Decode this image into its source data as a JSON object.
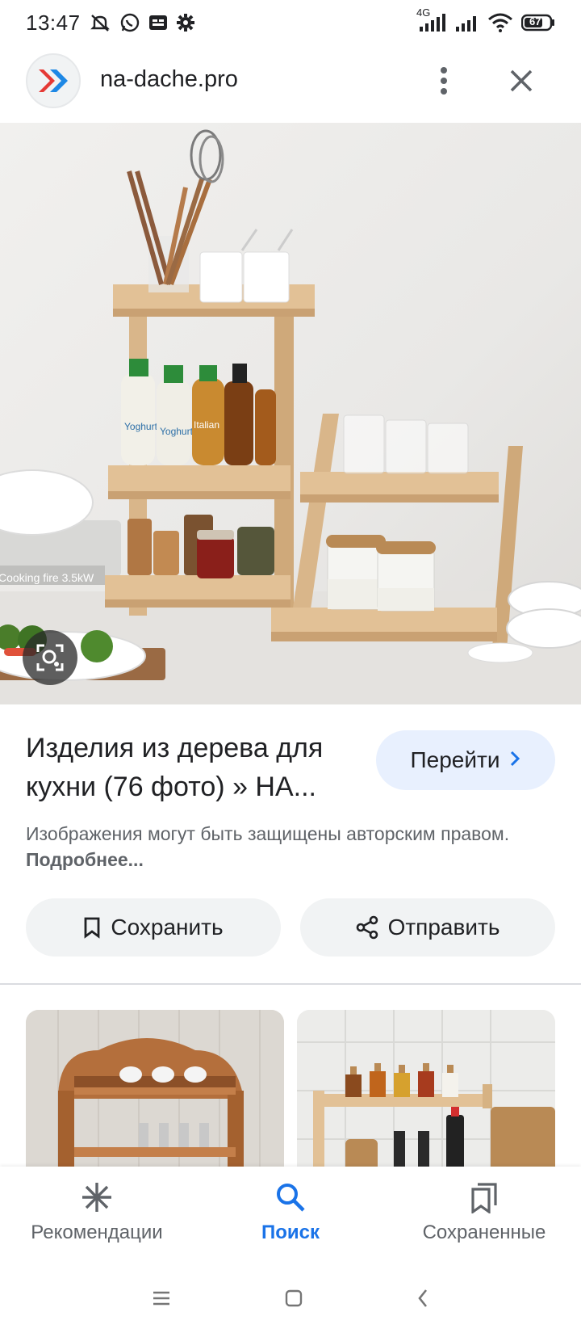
{
  "status_bar": {
    "time": "13:47",
    "network_label": "4G",
    "battery_level": "67"
  },
  "header": {
    "domain": "na-dache.pro"
  },
  "result": {
    "title": "Изделия из дерева для кухни (76 фото) » НА...",
    "visit_label": "Перейти",
    "copyright_text": "Изображения могут быть защищены авторским правом.",
    "copyright_more": "Подробнее..."
  },
  "actions": {
    "save_label": "Сохранить",
    "share_label": "Отправить"
  },
  "main_image_text": {
    "bottle_label_1": "Yoghurt",
    "bottle_label_2": "Yoghurt",
    "bottle_label_3": "Italian",
    "stove_text": "Cooking fire 3.5kW"
  },
  "bottom_nav": {
    "items": [
      {
        "label": "Рекомендации",
        "icon": "asterisk-icon",
        "active": false
      },
      {
        "label": "Поиск",
        "icon": "search-icon",
        "active": true
      },
      {
        "label": "Сохраненные",
        "icon": "saved-icon",
        "active": false
      }
    ]
  },
  "colors": {
    "accent": "#1a73e8",
    "visit_button_bg": "#e8f0fe",
    "action_button_bg": "#f1f3f4"
  }
}
